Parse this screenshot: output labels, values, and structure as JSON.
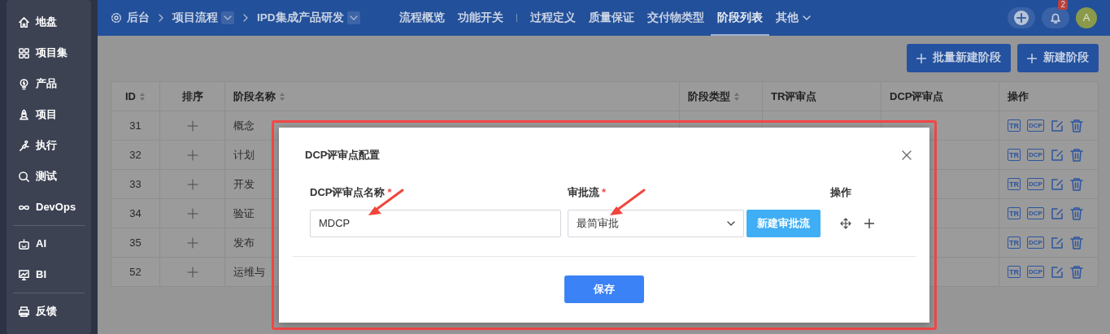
{
  "sidebar": {
    "groups": [
      [
        {
          "kind": "home",
          "label": "地盘"
        },
        {
          "kind": "grid",
          "label": "项目集"
        },
        {
          "kind": "bulb",
          "label": "产品"
        },
        {
          "kind": "rocket",
          "label": "项目"
        },
        {
          "kind": "run",
          "label": "执行"
        },
        {
          "kind": "search",
          "label": "测试"
        },
        {
          "kind": "infinity",
          "label": "DevOps"
        }
      ],
      [
        {
          "kind": "robot",
          "label": "AI"
        },
        {
          "kind": "board",
          "label": "BI"
        }
      ],
      [
        {
          "kind": "printer",
          "label": "反馈"
        }
      ]
    ]
  },
  "breadcrumb": [
    {
      "kind": "gear",
      "label": "后台",
      "dropdown": false
    },
    {
      "kind": "plain",
      "label": "项目流程",
      "dropdown": true
    },
    {
      "kind": "plain",
      "label": "IPD集成产品研发",
      "dropdown": true
    }
  ],
  "nav_tabs": [
    {
      "kind": "tab",
      "label": "流程概览",
      "selected": false,
      "dropdown": false
    },
    {
      "kind": "tab",
      "label": "功能开关",
      "selected": false,
      "dropdown": false
    },
    {
      "kind": "separator"
    },
    {
      "kind": "tab",
      "label": "过程定义",
      "selected": false,
      "dropdown": false
    },
    {
      "kind": "tab",
      "label": "质量保证",
      "selected": false,
      "dropdown": false
    },
    {
      "kind": "tab",
      "label": "交付物类型",
      "selected": false,
      "dropdown": false
    },
    {
      "kind": "tab",
      "label": "阶段列表",
      "selected": true,
      "dropdown": false
    },
    {
      "kind": "tab",
      "label": "其他",
      "selected": false,
      "dropdown": true
    }
  ],
  "notifications": {
    "badge": "2"
  },
  "avatar": {
    "initial": "A"
  },
  "toolbar_buttons": [
    "批量新建阶段",
    "新建阶段"
  ],
  "table": {
    "columns": [
      {
        "label": "ID",
        "sortable": true
      },
      {
        "label": "排序",
        "sortable": false
      },
      {
        "label": "阶段名称",
        "sortable": true
      },
      {
        "label": "阶段类型",
        "sortable": true
      },
      {
        "label": "TR评审点",
        "sortable": false
      },
      {
        "label": "DCP评审点",
        "sortable": false
      },
      {
        "label": "操作",
        "sortable": false
      }
    ],
    "rows": [
      {
        "id": "31",
        "name": "概念",
        "actions": [
          {
            "kind": "tag",
            "text": "TR"
          },
          {
            "kind": "tag",
            "text": "DCP"
          },
          {
            "kind": "edit"
          },
          {
            "kind": "delete"
          }
        ]
      },
      {
        "id": "32",
        "name": "计划",
        "actions": [
          {
            "kind": "tag",
            "text": "TR"
          },
          {
            "kind": "tag",
            "text": "DCP"
          },
          {
            "kind": "edit"
          },
          {
            "kind": "delete"
          }
        ]
      },
      {
        "id": "33",
        "name": "开发",
        "actions": [
          {
            "kind": "tag",
            "text": "TR"
          },
          {
            "kind": "tag",
            "text": "DCP"
          },
          {
            "kind": "edit"
          },
          {
            "kind": "delete"
          }
        ]
      },
      {
        "id": "34",
        "name": "验证",
        "actions": [
          {
            "kind": "tag",
            "text": "TR"
          },
          {
            "kind": "tag",
            "text": "DCP"
          },
          {
            "kind": "edit"
          },
          {
            "kind": "delete"
          }
        ]
      },
      {
        "id": "35",
        "name": "发布",
        "actions": [
          {
            "kind": "tag",
            "text": "TR"
          },
          {
            "kind": "tag",
            "text": "DCP"
          },
          {
            "kind": "edit"
          },
          {
            "kind": "delete"
          }
        ]
      },
      {
        "id": "52",
        "name": "运维与",
        "actions": [
          {
            "kind": "tag",
            "text": "TR"
          },
          {
            "kind": "tag",
            "text": "DCP"
          },
          {
            "kind": "edit"
          },
          {
            "kind": "delete"
          }
        ]
      }
    ]
  },
  "modal": {
    "title": "DCP评审点配置",
    "highlighted": true,
    "columns": [
      {
        "label": "DCP评审点名称",
        "required": true,
        "required_mark": "*"
      },
      {
        "label": "审批流",
        "required": true,
        "required_mark": "*"
      },
      {
        "label": "操作"
      }
    ],
    "name_field": {
      "value": "MDCP",
      "annotated": true
    },
    "flow_select": {
      "value": "最简审批",
      "annotated": true
    },
    "new_flow_button": "新建审批流",
    "save_button": "保存"
  }
}
